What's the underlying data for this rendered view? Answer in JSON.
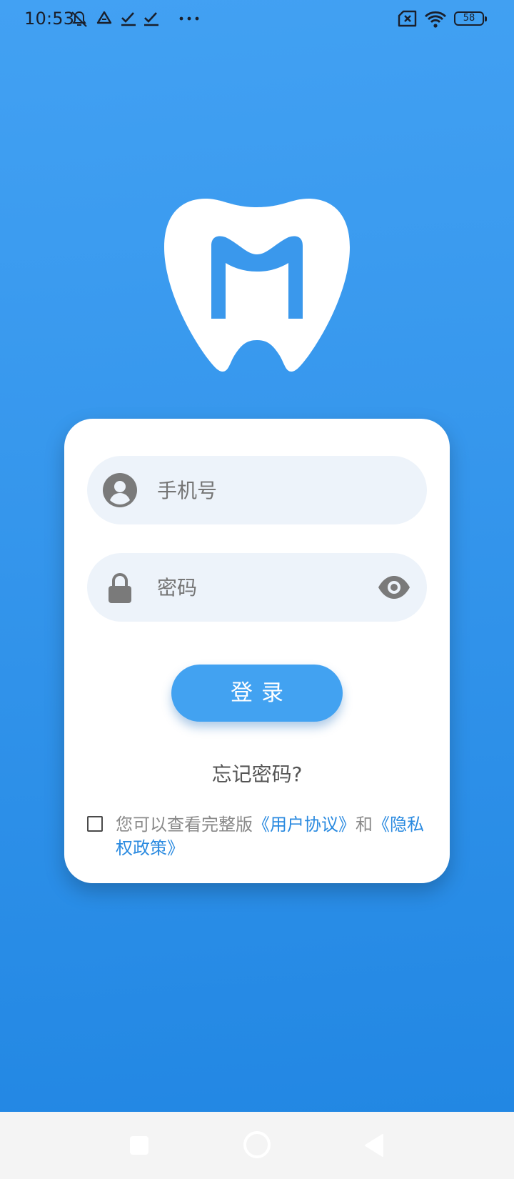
{
  "status_bar": {
    "time": "10:53",
    "battery": "58",
    "icons": [
      "mute-icon",
      "drive-icon",
      "check-icon",
      "check-icon",
      "more-dots-icon",
      "sim-error-icon",
      "wifi-icon",
      "battery-icon"
    ]
  },
  "login": {
    "phone_placeholder": "手机号",
    "password_placeholder": "密码",
    "login_button": "登录",
    "forgot_password": "忘记密码?",
    "agreement": {
      "prefix": "您可以查看完整版",
      "user_agreement": "《用户协议》",
      "and": "和",
      "privacy_policy": "《隐私权政策》"
    }
  },
  "colors": {
    "background_top": "#42a1f3",
    "background_bottom": "#2287e3",
    "button": "#42a2f1",
    "link": "#2a8ae0",
    "field_bg": "#edf3fa"
  }
}
